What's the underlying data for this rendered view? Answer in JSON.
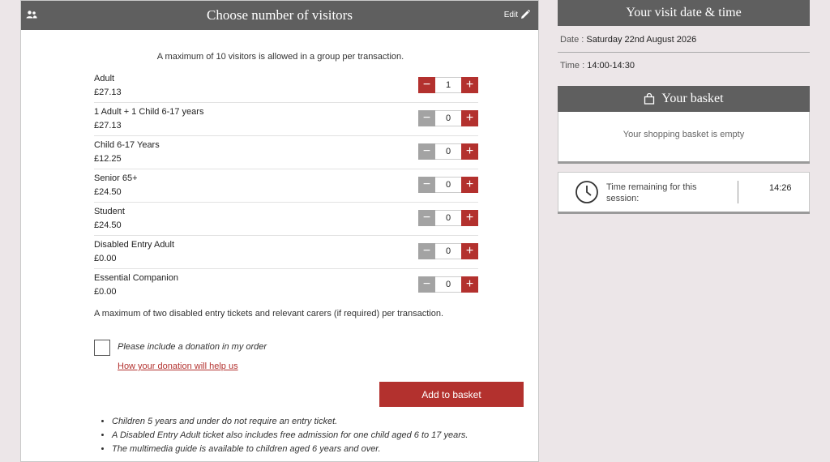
{
  "visitors": {
    "title": "Choose number of visitors",
    "edit_label": "Edit",
    "max_note": "A maximum of 10 visitors is allowed in a group per transaction.",
    "tickets": [
      {
        "name": "Adult",
        "price": "£27.13",
        "qty": "1"
      },
      {
        "name": "1 Adult + 1 Child 6-17 years",
        "price": "£27.13",
        "qty": "0"
      },
      {
        "name": "Child 6-17 Years",
        "price": "£12.25",
        "qty": "0"
      },
      {
        "name": "Senior 65+",
        "price": "£24.50",
        "qty": "0"
      },
      {
        "name": "Student",
        "price": "£24.50",
        "qty": "0"
      },
      {
        "name": "Disabled Entry Adult",
        "price": "£0.00",
        "qty": "0"
      },
      {
        "name": "Essential Companion",
        "price": "£0.00",
        "qty": "0"
      }
    ],
    "minus_symbol": "−",
    "plus_symbol": "+",
    "disabled_note": "A maximum of two disabled entry tickets and relevant carers (if required) per transaction.",
    "donation_label": "Please include a donation in my order",
    "donation_link": "How your donation will help us",
    "add_button": "Add to basket",
    "notes": [
      "Children 5 years and under do not require an entry ticket.",
      "A Disabled Entry Adult ticket also includes free admission for one child aged 6 to 17 years.",
      "The multimedia guide is available to children aged 6 years and over."
    ]
  },
  "visit": {
    "title": "Your visit date & time",
    "date_label": "Date :",
    "date_value": "Saturday 22nd August 2026",
    "time_label": "Time :",
    "time_value": "14:00-14:30"
  },
  "basket": {
    "title": "Your basket",
    "empty_text": "Your shopping basket is empty"
  },
  "timer": {
    "label": "Time remaining for this session:",
    "value": "14:26"
  },
  "colors": {
    "accent": "#b3312e",
    "header": "#5f5f5f",
    "background": "#ece6e8"
  },
  "icons": {
    "people": "people-icon",
    "edit": "pencil-icon",
    "bag": "shopping-bag-icon",
    "clock": "clock-icon"
  }
}
